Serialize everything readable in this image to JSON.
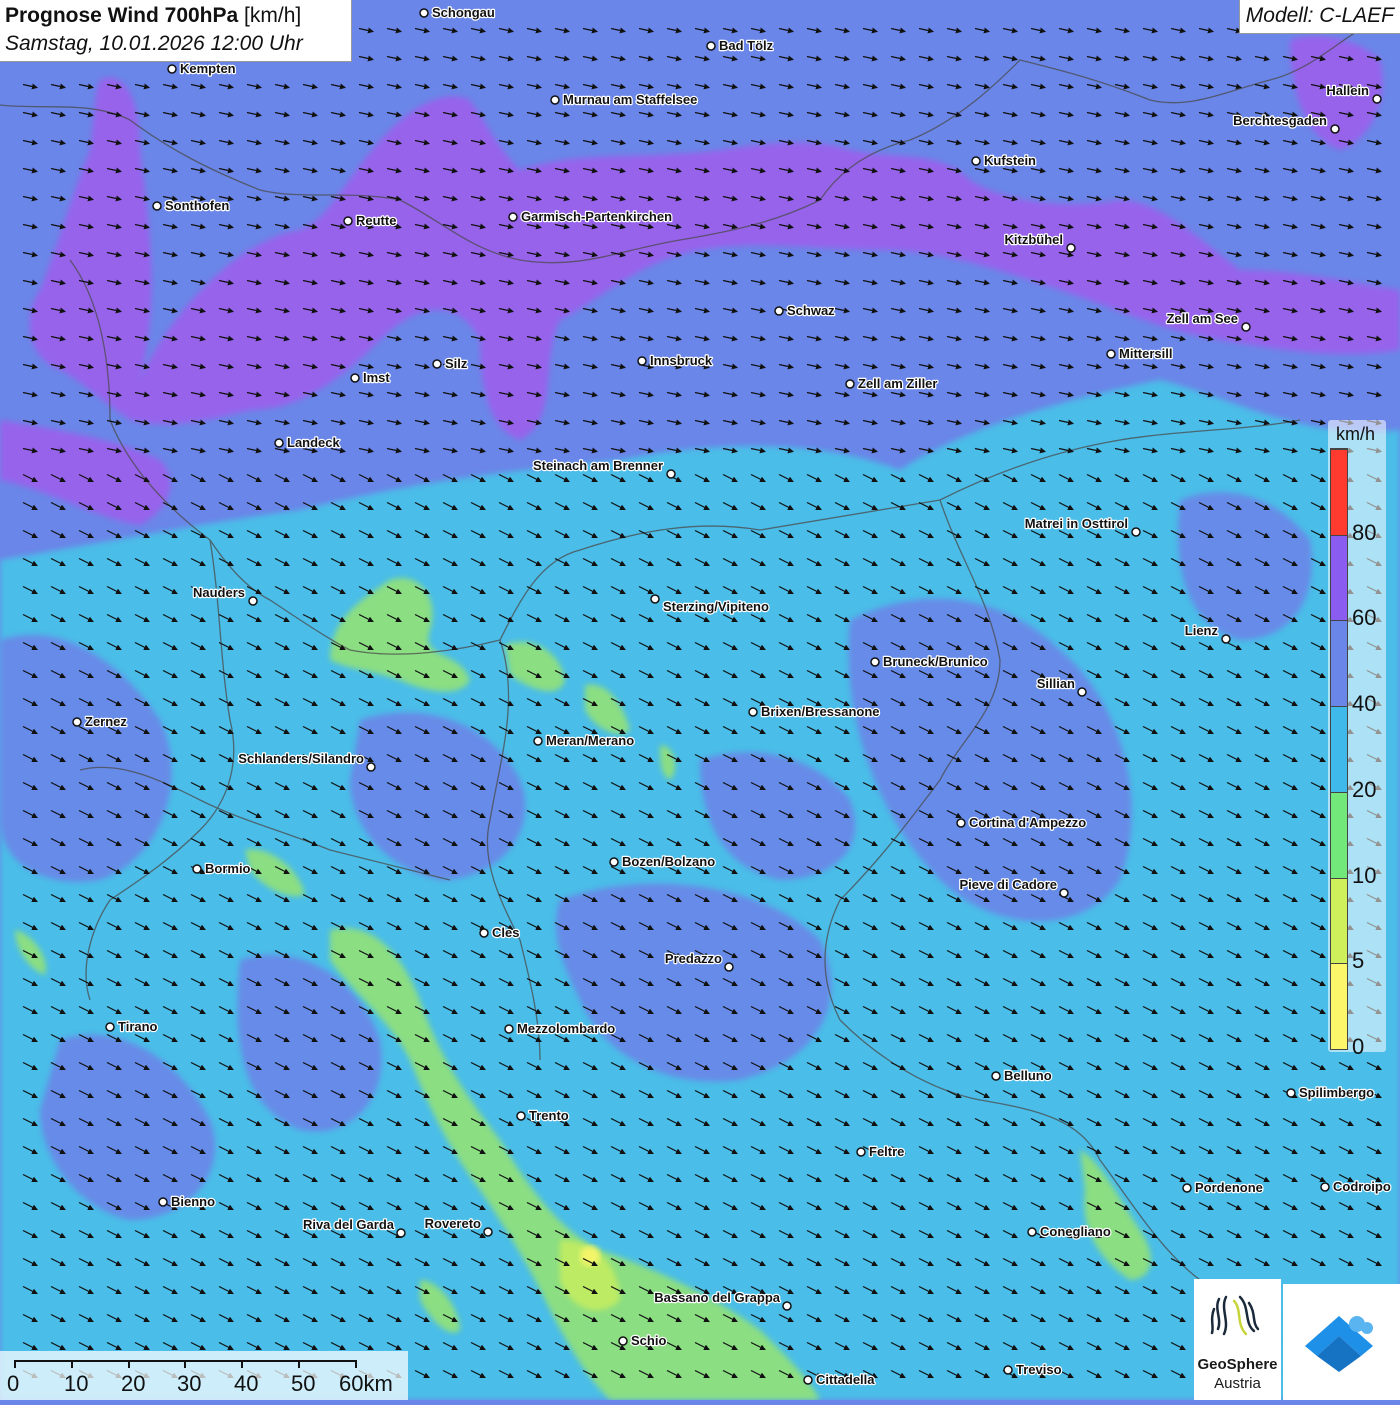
{
  "header": {
    "title_bold": "Prognose Wind 700hPa",
    "title_unit": "[km/h]",
    "datetime": "Samstag, 10.01.2026 12:00 Uhr"
  },
  "model": {
    "label": "Modell: C-LAEF"
  },
  "legend": {
    "unit": "km/h",
    "ticks": [
      "80",
      "60",
      "40",
      "20",
      "10",
      "5",
      "0"
    ],
    "colors": [
      "#ff3b30",
      "#8a5cf0",
      "#6a86e8",
      "#3fb8ea",
      "#72e87a",
      "#cff05a",
      "#fbf66a"
    ]
  },
  "scale": {
    "labels": [
      "0",
      "10",
      "20",
      "30",
      "40",
      "50",
      "60km"
    ]
  },
  "logos": {
    "geosphere_line1": "GeoSphere",
    "geosphere_line2": "Austria"
  },
  "map": {
    "fill_colors": {
      "0_5": "#fbf66a",
      "5_10": "#cff05a",
      "10_20": "#8fe07d",
      "20_40": "#48c0e8",
      "40_60": "#6a86e8",
      "60_80": "#9a62ec"
    },
    "wind_direction": "north-west",
    "cities": [
      {
        "name": "Schongau"
      },
      {
        "name": "Bad Tölz"
      },
      {
        "name": "Kempten"
      },
      {
        "name": "Murnau am Staffelsee"
      },
      {
        "name": "Hallein"
      },
      {
        "name": "Berchtesgaden"
      },
      {
        "name": "Kufstein"
      },
      {
        "name": "Sonthofen"
      },
      {
        "name": "Reutte"
      },
      {
        "name": "Garmisch-Partenkirchen"
      },
      {
        "name": "Kitzbühel"
      },
      {
        "name": "Schwaz"
      },
      {
        "name": "Zell am See"
      },
      {
        "name": "Mittersill"
      },
      {
        "name": "Innsbruck"
      },
      {
        "name": "Silz"
      },
      {
        "name": "Imst"
      },
      {
        "name": "Zell am Ziller"
      },
      {
        "name": "Landeck"
      },
      {
        "name": "Steinach am Brenner"
      },
      {
        "name": "Matrei in Osttirol"
      },
      {
        "name": "Nauders"
      },
      {
        "name": "Sterzing/Vipiteno"
      },
      {
        "name": "Lienz"
      },
      {
        "name": "Bruneck/Brunico"
      },
      {
        "name": "Sillian"
      },
      {
        "name": "Brixen/Bressanone"
      },
      {
        "name": "Zernez"
      },
      {
        "name": "Meran/Merano"
      },
      {
        "name": "Schlanders/Silandro"
      },
      {
        "name": "Cortina d'Ampezzo"
      },
      {
        "name": "Bozen/Bolzano"
      },
      {
        "name": "Bormio"
      },
      {
        "name": "Pieve di Cadore"
      },
      {
        "name": "Cles"
      },
      {
        "name": "Predazzo"
      },
      {
        "name": "Tirano"
      },
      {
        "name": "Mezzolombardo"
      },
      {
        "name": "Belluno"
      },
      {
        "name": "Spilimbergo"
      },
      {
        "name": "Trento"
      },
      {
        "name": "Feltre"
      },
      {
        "name": "Pordenone"
      },
      {
        "name": "Codroipo"
      },
      {
        "name": "Bienno"
      },
      {
        "name": "Riva del Garda"
      },
      {
        "name": "Rovereto"
      },
      {
        "name": "Conegliano"
      },
      {
        "name": "Bassano del Grappa"
      },
      {
        "name": "Schio"
      },
      {
        "name": "Treviso"
      },
      {
        "name": "Cittadella"
      }
    ]
  }
}
